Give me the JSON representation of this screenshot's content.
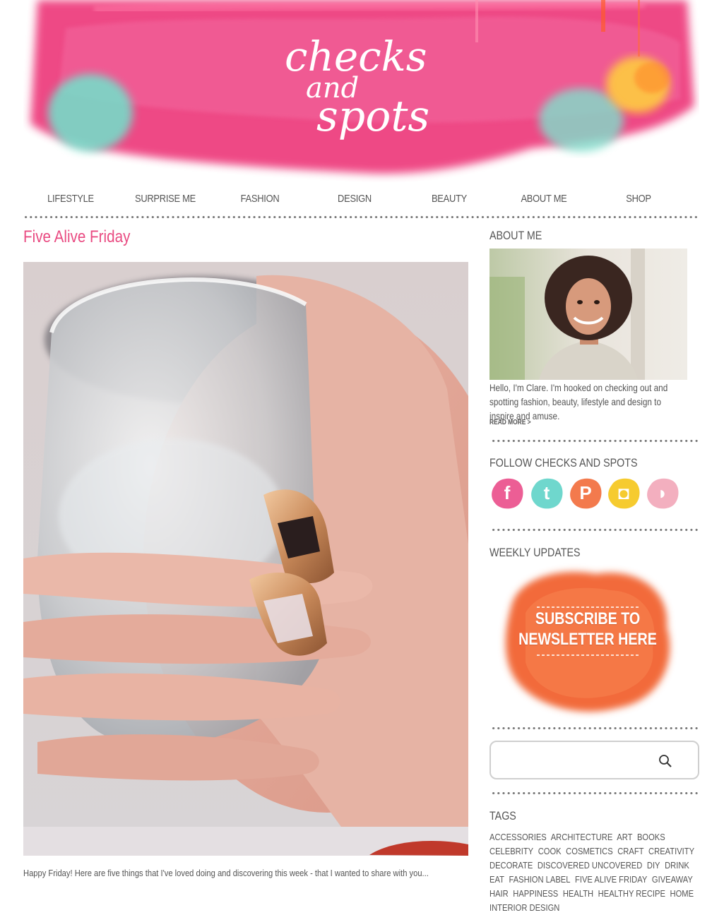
{
  "site": {
    "logo_line1": "checks",
    "logo_line2": "and",
    "logo_line3": "spots",
    "brand_color": "#e94b82"
  },
  "nav": {
    "items": [
      "LIFESTYLE",
      "SURPRISE ME",
      "FASHION",
      "DESIGN",
      "BEAUTY",
      "ABOUT ME",
      "SHOP"
    ]
  },
  "post": {
    "title": "Five Alive Friday",
    "excerpt": "Happy Friday! Here are five things that I've loved doing and discovering this week - that I wanted to share with you..."
  },
  "sidebar": {
    "about": {
      "heading": "ABOUT ME",
      "text": "Hello, I'm Clare. I'm hooked on checking out and spotting fashion, beauty, lifestyle and design to inspire and amuse.",
      "read_more": "READ MORE >"
    },
    "follow": {
      "heading": "FOLLOW CHECKS AND SPOTS",
      "icons": [
        {
          "name": "facebook-icon",
          "glyph": "f",
          "color": "#ea4c89"
        },
        {
          "name": "twitter-icon",
          "glyph": "t",
          "color": "#5fd3c8"
        },
        {
          "name": "pinterest-icon",
          "glyph": "P",
          "color": "#f26b3a"
        },
        {
          "name": "instagram-icon",
          "glyph": "◘",
          "color": "#f5c518"
        },
        {
          "name": "rss-icon",
          "glyph": "◗",
          "color": "#f2a6b8"
        }
      ]
    },
    "weekly": {
      "heading": "WEEKLY UPDATES",
      "line1": "SUBSCRIBE TO",
      "line2": "NEWSLETTER HERE"
    },
    "search": {
      "placeholder": ""
    },
    "tags": {
      "heading": "TAGS",
      "items": [
        "ACCESSORIES",
        "ARCHITECTURE",
        "ART",
        "BOOKS",
        "CELEBRITY",
        "COOK",
        "COSMETICS",
        "CRAFT",
        "CREATIVITY",
        "DECORATE",
        "DISCOVERED UNCOVERED",
        "DIY",
        "DRINK",
        "EAT",
        "FASHION LABEL",
        "FIVE ALIVE FRIDAY",
        "GIVEAWAY",
        "HAIR",
        "HAPPINESS",
        "HEALTH",
        "HEALTHY RECIPE",
        "HOME",
        "INTERIOR DESIGN"
      ]
    }
  }
}
